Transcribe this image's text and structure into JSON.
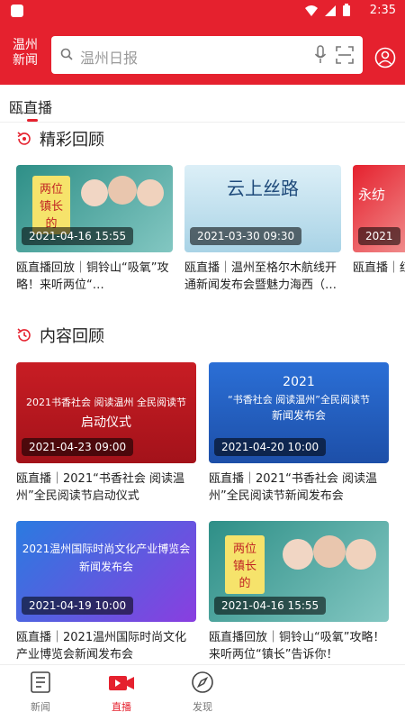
{
  "status": {
    "time": "2:35"
  },
  "header": {
    "logo_line1": "温州",
    "logo_line2": "新闻",
    "search_placeholder": "温州日报"
  },
  "tab": {
    "label": "瓯直播"
  },
  "section1": {
    "title": "精彩回顾",
    "items": [
      {
        "time": "2021-04-16 15:55",
        "caption": "瓯直播回放｜铜铃山“吸氧”攻略！来听两位“…",
        "thumb_text": "两位 镇长 的"
      },
      {
        "time": "2021-03-30 09:30",
        "caption": "瓯直播｜温州至格尔木航线开通新闻发布会暨魅力海西（…",
        "thumb_text": "云上丝路"
      },
      {
        "time": "2021",
        "caption": "瓯直播｜红蝴蝶…",
        "thumb_text": "永纺"
      }
    ]
  },
  "section2": {
    "title": "内容回顾",
    "items": [
      {
        "time": "2021-04-23 09:00",
        "caption": "瓯直播｜2021“书香社会 阅读温州”全民阅读节启动仪式",
        "thumb_line1": "2021书香社会 阅读温州 全民阅读节",
        "thumb_line2": "启动仪式"
      },
      {
        "time": "2021-04-20 10:00",
        "caption": "瓯直播｜2021“书香社会 阅读温州”全民阅读节新闻发布会",
        "thumb_line1": "2021",
        "thumb_line2": "“书香社会 阅读温州”全民阅读节",
        "thumb_line3": "新闻发布会"
      },
      {
        "time": "2021-04-19 10:00",
        "caption": "瓯直播｜2021温州国际时尚文化产业博览会新闻发布会",
        "thumb_line1": "2021温州国际时尚文化产业博览会",
        "thumb_line2": "新闻发布会"
      },
      {
        "time": "2021-04-16 15:55",
        "caption": "瓯直播回放｜铜铃山“吸氧”攻略！来听两位“镇长”告诉你！",
        "thumb_text": "两位 镇长 的"
      }
    ]
  },
  "nav": {
    "items": [
      {
        "label": "新闻"
      },
      {
        "label": "直播"
      },
      {
        "label": "发现"
      }
    ]
  },
  "colors": {
    "brand": "#e5212e"
  }
}
